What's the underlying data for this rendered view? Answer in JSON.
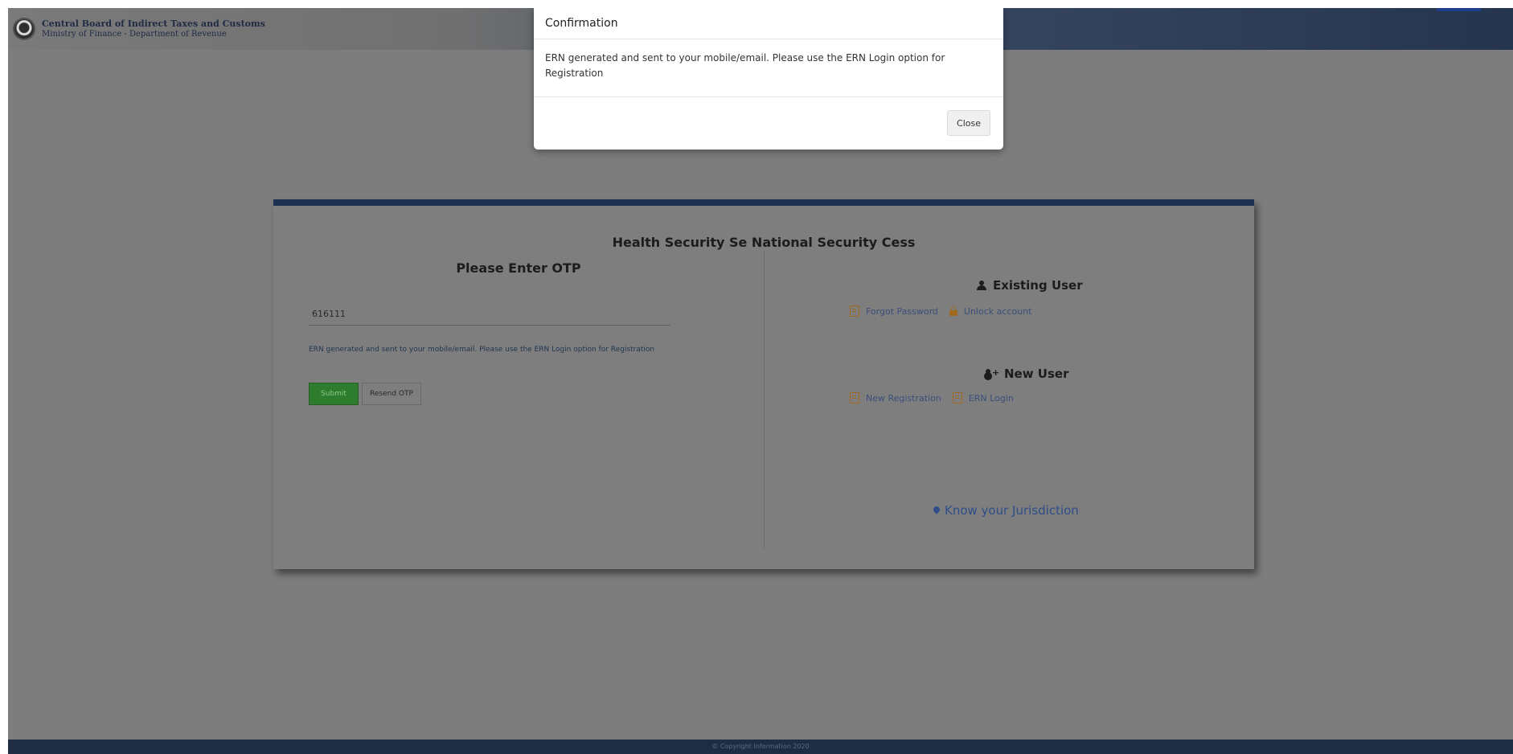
{
  "header": {
    "org_name": "Central Board of Indirect Taxes and Customs",
    "org_sub": "Ministry of Finance - Department of Revenue"
  },
  "card": {
    "title": "Health Security Se National Security Cess",
    "otp": {
      "heading": "Please Enter OTP",
      "input_value": "616111",
      "message": "ERN generated and sent to your mobile/email. Please use the ERN Login option for Registration",
      "submit_label": "Submit",
      "resend_label": "Resend OTP"
    },
    "existing_user": {
      "heading": "Existing User",
      "forgot_password": "Forgot Password",
      "unlock_account": "Unlock account"
    },
    "new_user": {
      "heading": "New User",
      "new_registration": "New Registration",
      "ern_login": "ERN Login"
    },
    "know_jurisdiction": "Know your Jurisdiction"
  },
  "footer": {
    "text": "© Copyright Information 2020"
  },
  "modal": {
    "title": "Confirmation",
    "body": "ERN generated and sent to your mobile/email. Please use the ERN Login option for Registration",
    "close_label": "Close"
  },
  "colors": {
    "header_dark": "#25344f",
    "submit_green": "#2e7d2e",
    "link_blue": "#2e4d8a",
    "icon_orange": "#a06a1e"
  }
}
